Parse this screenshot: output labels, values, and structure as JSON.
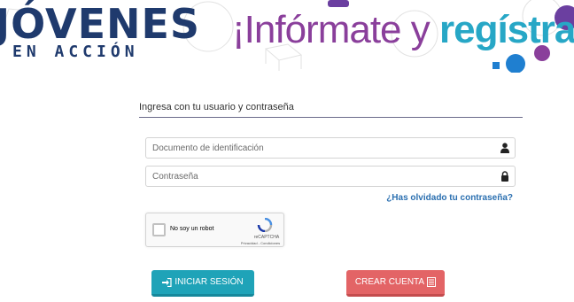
{
  "header": {
    "logo_main": "JÓVENES",
    "logo_sub": "EN ACCIÓN",
    "slogan_part1": "¡Infórmate y ",
    "slogan_part2": "regístrate!"
  },
  "login": {
    "title": "Ingresa con tu usuario y contraseña",
    "username_placeholder": "Documento de identificación",
    "username_icon": "user-icon",
    "password_placeholder": "Contraseña",
    "password_icon": "lock-icon",
    "forgot_link": "¿Has olvidado tu contraseña?",
    "captcha": {
      "label": "No soy un robot",
      "brand": "reCAPTCHA",
      "links": "Privacidad - Condiciones"
    },
    "login_button": "INICIAR SESIÓN",
    "login_icon": "sign-in-icon",
    "register_button": "CREAR CUENTA",
    "register_icon": "list-icon"
  },
  "colors": {
    "navy": "#1f3a6d",
    "purple": "#8a3f9b",
    "cyan": "#27a7c6",
    "link": "#2a6fb0",
    "login_button": "#1fa3b8",
    "register_button": "#e36466"
  }
}
